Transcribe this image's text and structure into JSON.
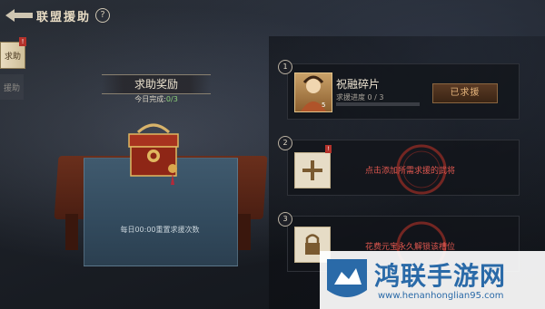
{
  "header": {
    "title": "联盟援助",
    "help": "?"
  },
  "side_tabs": [
    {
      "label": "求助",
      "active": true,
      "badge": "!"
    },
    {
      "label": "援助",
      "active": false
    }
  ],
  "reward": {
    "title": "求助奖励",
    "progress_label": "今日完成:",
    "progress_value": "0/3",
    "reset_note": "每日00:00重置求援次数"
  },
  "slots": [
    {
      "number": "1",
      "hero_name": "祝融碎片",
      "hero_level": "5",
      "progress_label": "求援进度 0 / 3",
      "progress_fraction": 0.0,
      "button_label": "已求援"
    },
    {
      "number": "2",
      "badge": "!",
      "hint": "点击添加所需求援的武将"
    },
    {
      "number": "3",
      "hint": "花费元宝永久解锁该槽位"
    }
  ],
  "watermark": {
    "title": "鸿联手游网",
    "url": "www.henanhonglian95.com"
  },
  "colors": {
    "accent_gold": "#c9b07a",
    "hint_red": "#e0574f",
    "progress_green": "#8fd27a"
  }
}
